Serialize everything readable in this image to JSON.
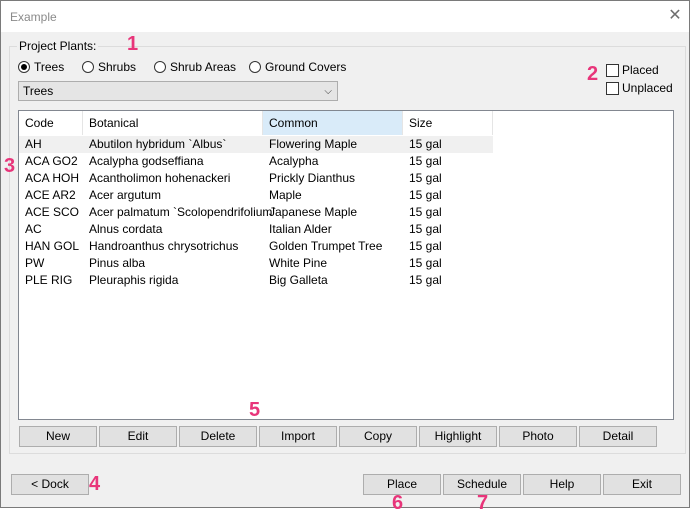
{
  "window": {
    "title": "Example",
    "close_symbol": "✕"
  },
  "group": {
    "label": "Project Plants:"
  },
  "radios": [
    {
      "label": "Trees",
      "selected": true
    },
    {
      "label": "Shrubs",
      "selected": false
    },
    {
      "label": "Shrub Areas",
      "selected": false
    },
    {
      "label": "Ground Covers",
      "selected": false
    }
  ],
  "category_select": {
    "value": "Trees",
    "arrow": "⌵"
  },
  "filters": {
    "placed": {
      "label": "Placed",
      "checked": false
    },
    "unplaced": {
      "label": "Unplaced",
      "checked": false
    }
  },
  "table": {
    "columns": [
      "Code",
      "Botanical",
      "Common",
      "Size"
    ],
    "rows": [
      [
        "AH",
        "Abutilon hybridum `Albus`",
        "Flowering Maple",
        "15 gal"
      ],
      [
        "ACA GO2",
        "Acalypha godseffiana",
        "Acalypha",
        "15 gal"
      ],
      [
        "ACA HOH",
        "Acantholimon hohenackeri",
        "Prickly Dianthus",
        "15 gal"
      ],
      [
        "ACE AR2",
        "Acer argutum",
        "Maple",
        "15 gal"
      ],
      [
        "ACE SCO",
        "Acer palmatum `Scolopendrifolium`",
        "Japanese Maple",
        "15 gal"
      ],
      [
        "AC",
        "Alnus cordata",
        "Italian Alder",
        "15 gal"
      ],
      [
        "HAN GOL",
        "Handroanthus chrysotrichus",
        "Golden Trumpet Tree",
        "15 gal"
      ],
      [
        "PW",
        "Pinus alba",
        "White Pine",
        "15 gal"
      ],
      [
        "PLE RIG",
        "Pleuraphis rigida",
        "Big Galleta",
        "15 gal"
      ]
    ]
  },
  "list_buttons": [
    "New",
    "Edit",
    "Delete",
    "Import",
    "Copy",
    "Highlight",
    "Photo",
    "Detail"
  ],
  "footer_buttons": {
    "dock": "< Dock",
    "place": "Place",
    "schedule": "Schedule",
    "help": "Help",
    "exit": "Exit"
  },
  "callouts": [
    "1",
    "2",
    "3",
    "4",
    "5",
    "6",
    "7"
  ],
  "colors": {
    "callout": "#e8357a",
    "sorted_header": "#d9ebf9"
  }
}
